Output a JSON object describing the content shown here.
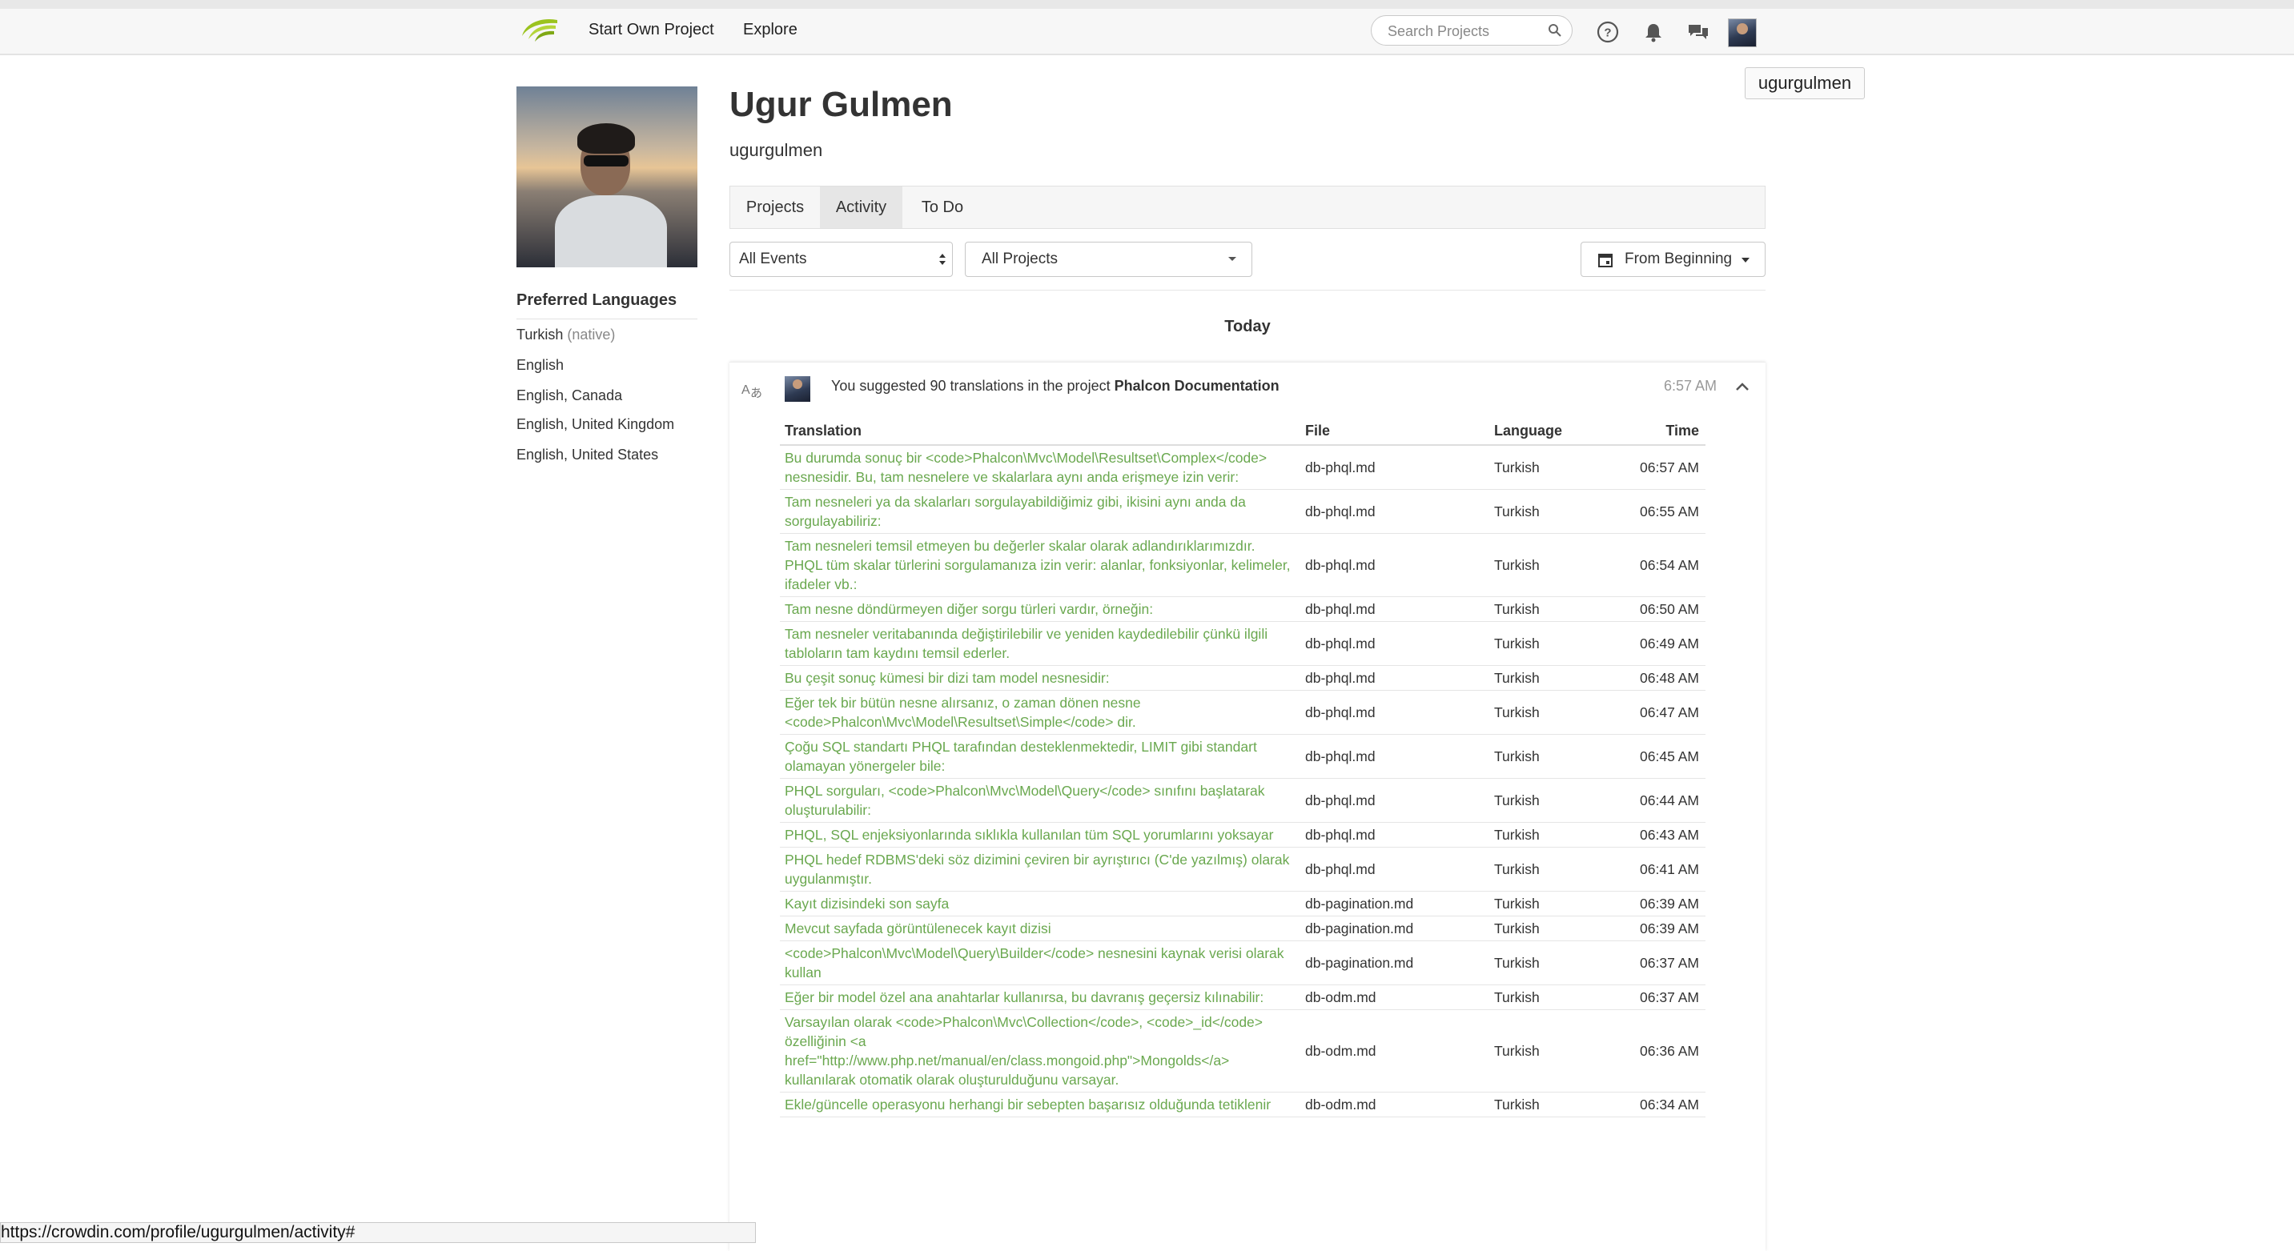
{
  "nav": {
    "start_project": "Start Own Project",
    "explore": "Explore",
    "search_placeholder": "Search Projects",
    "tooltip_username": "ugurgulmen"
  },
  "profile": {
    "full_name": "Ugur Gulmen",
    "username": "ugurgulmen",
    "preferred_languages_title": "Preferred Languages",
    "languages": [
      {
        "name": "Turkish",
        "note": "(native)"
      },
      {
        "name": "English",
        "note": ""
      },
      {
        "name": "English, Canada",
        "note": ""
      },
      {
        "name": "English, United Kingdom",
        "note": ""
      },
      {
        "name": "English, United States",
        "note": ""
      }
    ]
  },
  "tabs": [
    {
      "label": "Projects",
      "active": false
    },
    {
      "label": "Activity",
      "active": true
    },
    {
      "label": "To Do",
      "active": false
    }
  ],
  "filters": {
    "events": "All Events",
    "projects": "All Projects",
    "date": "From Beginning"
  },
  "day_label": "Today",
  "event": {
    "text_prefix": "You suggested 90 translations in the project ",
    "project": "Phalcon Documentation",
    "time": "6:57 AM"
  },
  "table": {
    "headers": {
      "translation": "Translation",
      "file": "File",
      "language": "Language",
      "time": "Time"
    },
    "rows": [
      {
        "translation": "Bu durumda sonuç bir <code>Phalcon\\Mvc\\Model\\Resultset\\Complex</code> nesnesidir. Bu, tam nesnelere ve skalarlara aynı anda erişmeye izin verir:",
        "file": "db-phql.md",
        "language": "Turkish",
        "time": "06:57 AM"
      },
      {
        "translation": "Tam nesneleri ya da skalarları sorgulayabildiğimiz gibi, ikisini aynı anda da sorgulayabiliriz:",
        "file": "db-phql.md",
        "language": "Turkish",
        "time": "06:55 AM"
      },
      {
        "translation": "Tam nesneleri temsil etmeyen bu değerler skalar olarak adlandırıklarımızdır. PHQL tüm skalar türlerini sorgulamanıza izin verir: alanlar, fonksiyonlar, kelimeler, ifadeler vb.:",
        "file": "db-phql.md",
        "language": "Turkish",
        "time": "06:54 AM"
      },
      {
        "translation": "Tam nesne döndürmeyen diğer sorgu türleri vardır, örneğin:",
        "file": "db-phql.md",
        "language": "Turkish",
        "time": "06:50 AM"
      },
      {
        "translation": "Tam nesneler veritabanında değiştirilebilir ve yeniden kaydedilebilir çünkü ilgili tabloların tam kaydını temsil ederler.",
        "file": "db-phql.md",
        "language": "Turkish",
        "time": "06:49 AM"
      },
      {
        "translation": "Bu çeşit sonuç kümesi bir dizi tam model nesnesidir:",
        "file": "db-phql.md",
        "language": "Turkish",
        "time": "06:48 AM"
      },
      {
        "translation": "Eğer tek bir bütün nesne alırsanız, o zaman dönen nesne <code>Phalcon\\Mvc\\Model\\Resultset\\Simple</code> dir.",
        "file": "db-phql.md",
        "language": "Turkish",
        "time": "06:47 AM"
      },
      {
        "translation": "Çoğu SQL standartı PHQL tarafından desteklenmektedir, LIMIT gibi standart olamayan yönergeler bile:",
        "file": "db-phql.md",
        "language": "Turkish",
        "time": "06:45 AM"
      },
      {
        "translation": "PHQL sorguları, <code>Phalcon\\Mvc\\Model\\Query</code> sınıfını başlatarak oluşturulabilir:",
        "file": "db-phql.md",
        "language": "Turkish",
        "time": "06:44 AM"
      },
      {
        "translation": "PHQL, SQL enjeksiyonlarında sıklıkla kullanılan tüm SQL yorumlarını yoksayar",
        "file": "db-phql.md",
        "language": "Turkish",
        "time": "06:43 AM"
      },
      {
        "translation": "PHQL hedef RDBMS'deki söz dizimini çeviren bir ayrıştırıcı (C'de yazılmış) olarak uygulanmıştır.",
        "file": "db-phql.md",
        "language": "Turkish",
        "time": "06:41 AM"
      },
      {
        "translation": "Kayıt dizisindeki son sayfa",
        "file": "db-pagination.md",
        "language": "Turkish",
        "time": "06:39 AM"
      },
      {
        "translation": "Mevcut sayfada görüntülenecek kayıt dizisi",
        "file": "db-pagination.md",
        "language": "Turkish",
        "time": "06:39 AM"
      },
      {
        "translation": "<code>Phalcon\\Mvc\\Model\\Query\\Builder</code> nesnesini kaynak verisi olarak kullan",
        "file": "db-pagination.md",
        "language": "Turkish",
        "time": "06:37 AM"
      },
      {
        "translation": "Eğer bir model özel ana anahtarlar kullanırsa, bu davranış geçersiz kılınabilir:",
        "file": "db-odm.md",
        "language": "Turkish",
        "time": "06:37 AM"
      },
      {
        "translation": "Varsayılan olarak <code>Phalcon\\Mvc\\Collection</code>, <code>_id</code> özelliğinin <a href=\"http://www.php.net/manual/en/class.mongoid.php\">Mongolds</a> kullanılarak otomatik olarak oluşturulduğunu varsayar.",
        "file": "db-odm.md",
        "language": "Turkish",
        "time": "06:36 AM"
      },
      {
        "translation": "Ekle/güncelle operasyonu herhangi bir sebepten başarısız olduğunda tetiklenir",
        "file": "db-odm.md",
        "language": "Turkish",
        "time": "06:34 AM"
      }
    ]
  },
  "status_url": "https://crowdin.com/profile/ugurgulmen/activity#",
  "colors": {
    "translation_text": "#6aa84f",
    "logo_green": "#9bc31f"
  },
  "icons": [
    "logo-icon",
    "search-icon",
    "help-icon",
    "bell-icon",
    "messages-icon",
    "translate-icon",
    "calendar-icon",
    "chevron-up-icon",
    "caret-down-icon",
    "select-arrows-icon"
  ]
}
